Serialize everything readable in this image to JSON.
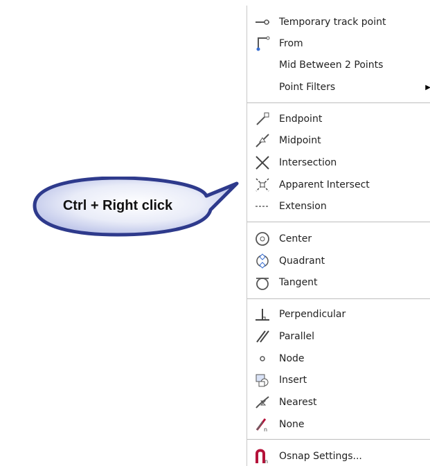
{
  "callout": {
    "text": "Ctrl + Right click"
  },
  "menu": {
    "items": [
      {
        "label": "Temporary track point",
        "icon": "temporary-track-point-icon"
      },
      {
        "label": "From",
        "icon": "from-icon"
      },
      {
        "label": "Mid Between 2 Points",
        "icon": ""
      },
      {
        "label": "Point Filters",
        "icon": "",
        "submenu": true
      },
      {
        "label": "Endpoint",
        "icon": "endpoint-icon"
      },
      {
        "label": "Midpoint",
        "icon": "midpoint-icon"
      },
      {
        "label": "Intersection",
        "icon": "intersection-icon"
      },
      {
        "label": "Apparent Intersect",
        "icon": "apparent-intersect-icon"
      },
      {
        "label": "Extension",
        "icon": "extension-icon"
      },
      {
        "label": "Center",
        "icon": "center-icon"
      },
      {
        "label": "Quadrant",
        "icon": "quadrant-icon"
      },
      {
        "label": "Tangent",
        "icon": "tangent-icon"
      },
      {
        "label": "Perpendicular",
        "icon": "perpendicular-icon"
      },
      {
        "label": "Parallel",
        "icon": "parallel-icon"
      },
      {
        "label": "Node",
        "icon": "node-icon"
      },
      {
        "label": "Insert",
        "icon": "insert-icon"
      },
      {
        "label": "Nearest",
        "icon": "nearest-icon"
      },
      {
        "label": "None",
        "icon": "none-icon"
      },
      {
        "label": "Osnap Settings...",
        "icon": "osnap-settings-icon"
      }
    ]
  }
}
